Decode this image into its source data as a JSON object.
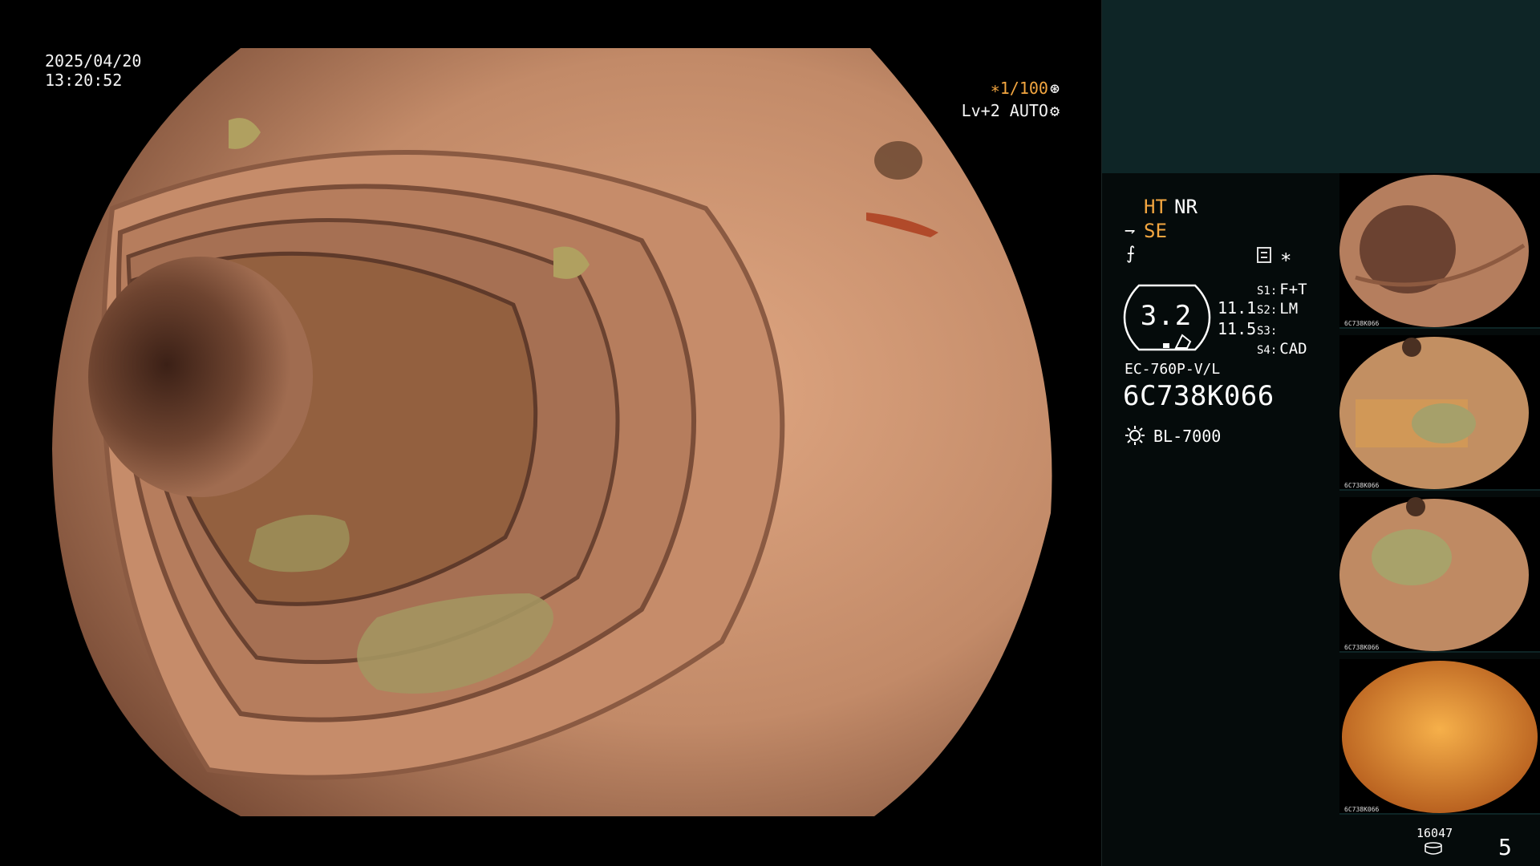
{
  "overlay": {
    "date": "2025/04/20",
    "time": "13:20:52",
    "shutter": "∗1/100",
    "level": "Lv+2 AUTO"
  },
  "status": {
    "ht": "HT",
    "nr": "NR",
    "se": "SE",
    "zoom": "3.2",
    "val1": "11.1",
    "val2": "11.5",
    "switches": [
      {
        "key": "S1:",
        "value": "F+T"
      },
      {
        "key": "S2:",
        "value": "LM"
      },
      {
        "key": "S3:",
        "value": ""
      },
      {
        "key": "S4:",
        "value": "CAD"
      }
    ],
    "model": "EC-760P-V/L",
    "serial": "6C738K066",
    "light_source": "BL-7000"
  },
  "thumbnails": [
    {
      "caption": "6C738K066"
    },
    {
      "caption": "6C738K066"
    },
    {
      "caption": "6C738K066"
    },
    {
      "caption": "6C738K066"
    }
  ],
  "footer": {
    "frame_count": "16047",
    "page": "5"
  },
  "colors": {
    "accent": "#f3a640",
    "panel": "#0e2526",
    "tissue": "#b07a5c"
  },
  "icons": [
    "gear-icon",
    "iris-icon",
    "se-icon",
    "flash-icon",
    "menu-icon",
    "gauge-icon",
    "sun-icon",
    "database-icon"
  ]
}
